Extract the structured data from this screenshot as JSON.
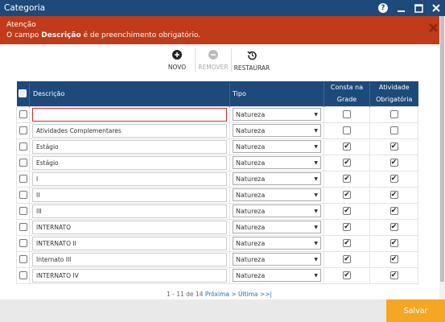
{
  "window": {
    "title": "Categoria"
  },
  "alert": {
    "title": "Atenção",
    "prefix": "O campo ",
    "field": "Descrição",
    "suffix": " é de preenchimento obrigatório."
  },
  "toolbar": {
    "new_label": "NOVO",
    "remove_label": "REMOVER",
    "restore_label": "RESTAURAR"
  },
  "columns": {
    "descricao": "Descrição",
    "tipo": "Tipo",
    "consta_a": "Consta na",
    "consta_b": "Grade",
    "ativ_a": "Atividade",
    "ativ_b": "Obrigatória"
  },
  "rows": [
    {
      "descricao": "",
      "tipo": "Natureza",
      "consta": false,
      "obrigatoria": false
    },
    {
      "descricao": "Atividades Complementares",
      "tipo": "Natureza",
      "consta": false,
      "obrigatoria": false
    },
    {
      "descricao": "Estágio",
      "tipo": "Natureza",
      "consta": true,
      "obrigatoria": true
    },
    {
      "descricao": "Estágio",
      "tipo": "Natureza",
      "consta": true,
      "obrigatoria": true
    },
    {
      "descricao": "I",
      "tipo": "Natureza",
      "consta": true,
      "obrigatoria": true
    },
    {
      "descricao": "II",
      "tipo": "Natureza",
      "consta": true,
      "obrigatoria": true
    },
    {
      "descricao": "III",
      "tipo": "Natureza",
      "consta": true,
      "obrigatoria": true
    },
    {
      "descricao": "INTERNATO",
      "tipo": "Natureza",
      "consta": true,
      "obrigatoria": true
    },
    {
      "descricao": "INTERNATO II",
      "tipo": "Natureza",
      "consta": true,
      "obrigatoria": true
    },
    {
      "descricao": "Internato III",
      "tipo": "Natureza",
      "consta": true,
      "obrigatoria": true
    },
    {
      "descricao": "INTERNATO IV",
      "tipo": "Natureza",
      "consta": true,
      "obrigatoria": true
    }
  ],
  "pager": {
    "range": "1 - 11 de 14 ",
    "next": "Próxima >",
    "last": "Última >>|"
  },
  "footer": {
    "save_label": "Salvar"
  },
  "colors": {
    "header": "#1d4a7a",
    "alert": "#bf3b1a",
    "save": "#f5a623"
  },
  "icons": {
    "help": "help-icon",
    "minimize": "minimize-icon",
    "maximize": "maximize-icon",
    "close": "close-icon",
    "new": "plus-circle-icon",
    "remove": "minus-circle-icon",
    "restore": "restore-icon"
  }
}
